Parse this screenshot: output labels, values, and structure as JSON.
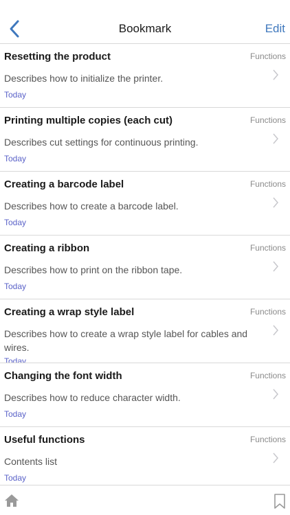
{
  "navbar": {
    "title": "Bookmark",
    "edit_label": "Edit",
    "back_icon": "chevron-left-icon"
  },
  "items": [
    {
      "title": "Resetting the product",
      "category": "Functions",
      "description": "Describes how to initialize the printer.",
      "date": "Today"
    },
    {
      "title": "Printing multiple copies (each cut)",
      "category": "Functions",
      "description": "Describes cut settings for continuous printing.",
      "date": "Today"
    },
    {
      "title": "Creating a barcode label",
      "category": "Functions",
      "description": "Describes how to create a barcode label.",
      "date": "Today"
    },
    {
      "title": "Creating a ribbon",
      "category": "Functions",
      "description": "Describes how to print on the ribbon tape.",
      "date": "Today"
    },
    {
      "title": "Creating a wrap style label",
      "category": "Functions",
      "description": "Describes how to create a wrap style label for cables and wires.",
      "date": "Today"
    },
    {
      "title": "Changing the font width",
      "category": "Functions",
      "description": "Describes how to reduce character width.",
      "date": "Today"
    },
    {
      "title": "Useful functions",
      "category": "Functions",
      "description": "Contents list",
      "date": "Today"
    }
  ],
  "bottombar": {
    "home_icon": "home-icon",
    "bookmark_icon": "bookmark-icon"
  },
  "colors": {
    "accent": "#3f78bd",
    "date": "#5a62c8",
    "separator": "#d8d8d8"
  }
}
